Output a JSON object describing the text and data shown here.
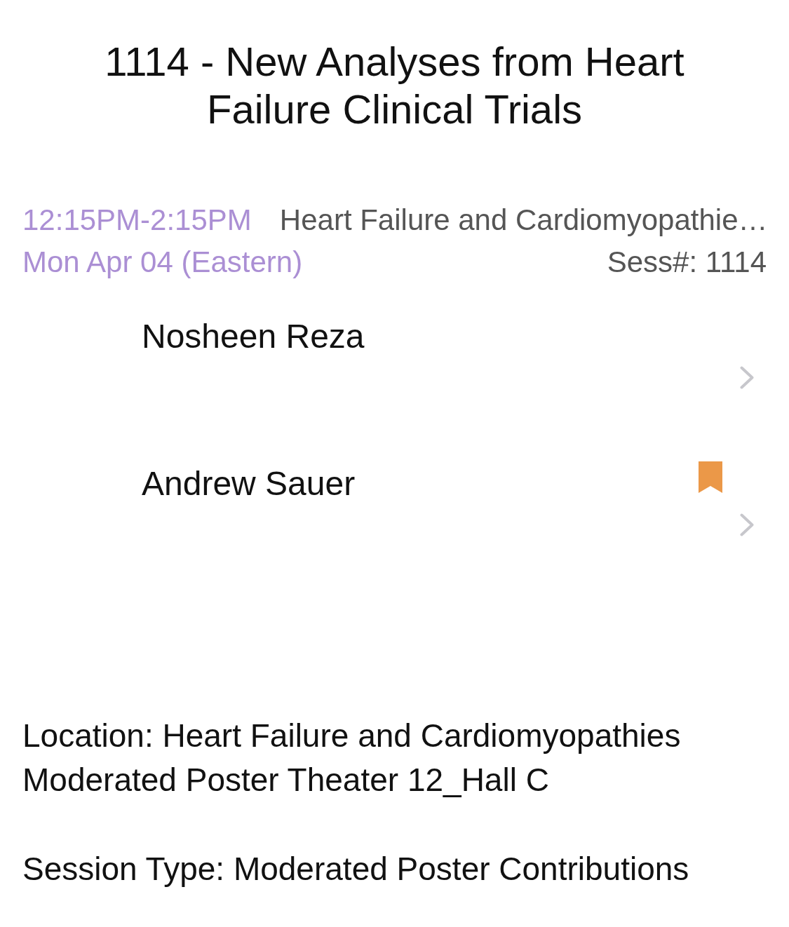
{
  "title": "1114 - New Analyses from Heart Failure Clinical Trials",
  "session": {
    "time": "12:15PM-2:15PM",
    "category": "Heart Failure and Cardiomyopathie…",
    "date": "Mon Apr 04 (Eastern)",
    "number": "Sess#: 1114"
  },
  "presenters": [
    {
      "name": "Nosheen Reza",
      "bookmarked": false
    },
    {
      "name": "Andrew Sauer",
      "bookmarked": true
    }
  ],
  "location": "Location: Heart Failure and Cardiomyopathies Moderated Poster Theater 12_Hall C",
  "session_type": "Session Type: Moderated Poster Contributions"
}
